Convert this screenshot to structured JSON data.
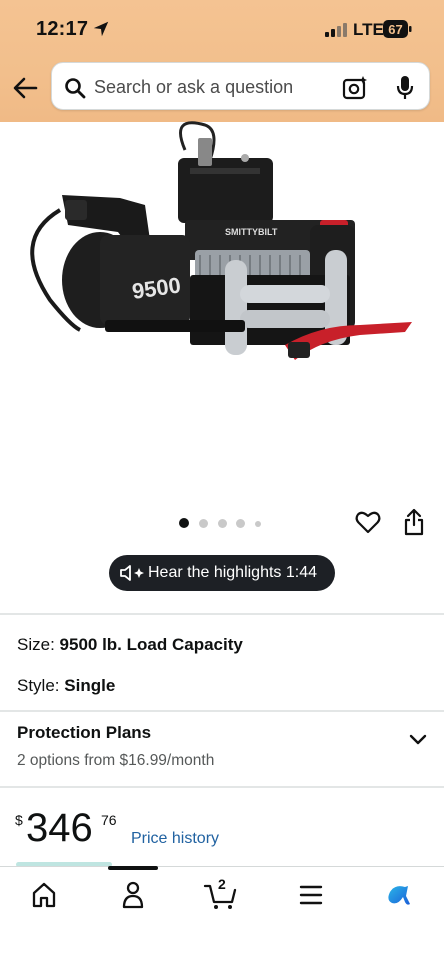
{
  "status_bar": {
    "time": "12:17",
    "network": "LTE",
    "battery": "67"
  },
  "search": {
    "placeholder": "Search or ask a question"
  },
  "product": {
    "image_brand_text": "SMITTYBILT",
    "image_model_text": "9500",
    "carousel": {
      "count": 5,
      "active_index": 0
    }
  },
  "highlights_button": {
    "label": "Hear the highlights 1:44"
  },
  "size": {
    "label": "Size:",
    "value": "9500 lb. Load Capacity"
  },
  "style": {
    "label": "Style:",
    "value": "Single"
  },
  "protection_plans": {
    "title": "Protection Plans",
    "subtitle": "2 options from $16.99/month"
  },
  "price": {
    "currency": "$",
    "whole": "346",
    "fraction": "76",
    "history_link": "Price history"
  },
  "bottom_nav": {
    "items": [
      {
        "icon": "home-icon"
      },
      {
        "icon": "account-icon",
        "active": true
      },
      {
        "icon": "cart-icon",
        "count": "2"
      },
      {
        "icon": "menu-icon"
      },
      {
        "icon": "rufus-icon"
      }
    ]
  },
  "colors": {
    "header_gradient": "#f2bf8c",
    "link": "#2162a1",
    "pill_bg": "#1d2025",
    "rufus_accent": "#1a8cd8"
  }
}
